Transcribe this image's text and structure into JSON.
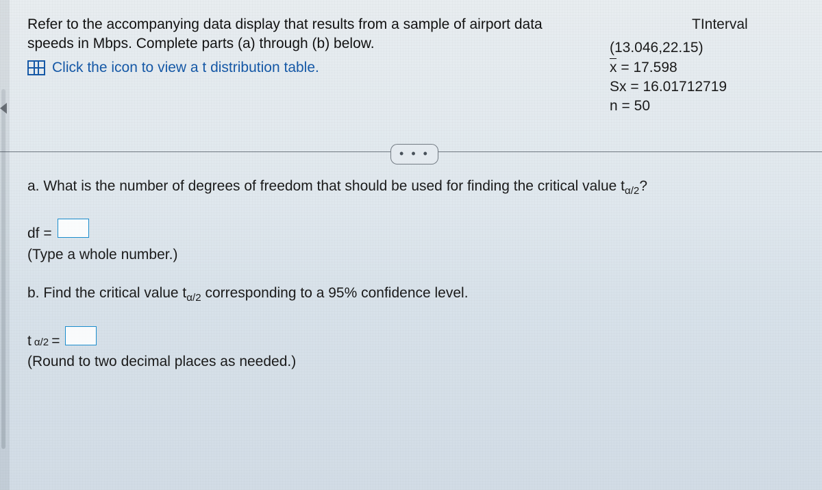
{
  "prompt": {
    "line1": "Refer to the accompanying data display that results from a sample of airport data",
    "line2": "speeds in Mbps. Complete parts (a) through (b) below.",
    "link": "Click the icon to view a t distribution table."
  },
  "calc": {
    "title": "TInterval",
    "interval": "(13.046,22.15)",
    "xbar_label": "x",
    "xbar_value": "17.598",
    "sx_label": "Sx",
    "sx_value": "16.01712719",
    "n_label": "n",
    "n_value": "50"
  },
  "expand": "• • •",
  "qa": {
    "a_text_pre": "a. What is the number of degrees of freedom that should be used for finding the critical value t",
    "a_sub": "α/2",
    "a_text_post": "?",
    "df_label": "df =",
    "df_hint": "(Type a whole number.)",
    "b_text_pre": "b. Find the critical value t",
    "b_sub": "α/2",
    "b_text_post": " corresponding to a 95% confidence level.",
    "t_label_pre": "t",
    "t_label_sub": "α/2",
    "t_label_post": " =",
    "t_hint": "(Round to two decimal places as needed.)"
  }
}
